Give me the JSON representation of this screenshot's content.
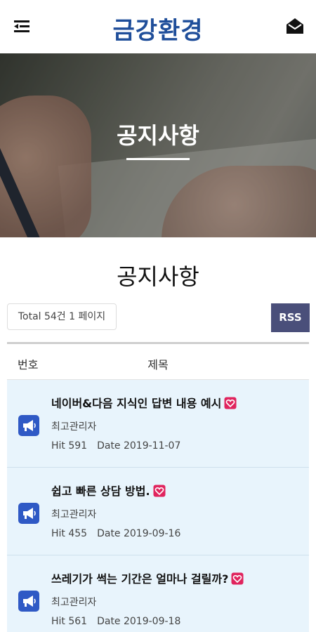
{
  "header": {
    "logo_text": "금강환경",
    "logo_color": "#1f4e9a",
    "menu_icon": "menu-icon",
    "mail_icon": "mail-icon"
  },
  "hero": {
    "title": "공지사항"
  },
  "section": {
    "title": "공지사항",
    "total_text": "Total 54건 1 페이지",
    "rss_label": "RSS",
    "rss_color": "#4a4f7a"
  },
  "table": {
    "col_num": "번호",
    "col_subject": "제목",
    "rows": [
      {
        "title": "네이버&다음 지식인 답변 내용 예시",
        "author": "최고관리자",
        "hit": "Hit 591",
        "date": "Date 2019-11-07"
      },
      {
        "title": "쉽고 빠른 상담 방법.",
        "author": "최고관리자",
        "hit": "Hit 455",
        "date": "Date 2019-09-16"
      },
      {
        "title": "쓰레기가 썩는 기간은 얼마나 걸릴까?",
        "author": "최고관리자",
        "hit": "Hit 561",
        "date": "Date 2019-09-18"
      }
    ]
  },
  "colors": {
    "row_background": "#e8f4fc",
    "notice_icon": "#2f59c5",
    "heart": "#e0245e"
  }
}
